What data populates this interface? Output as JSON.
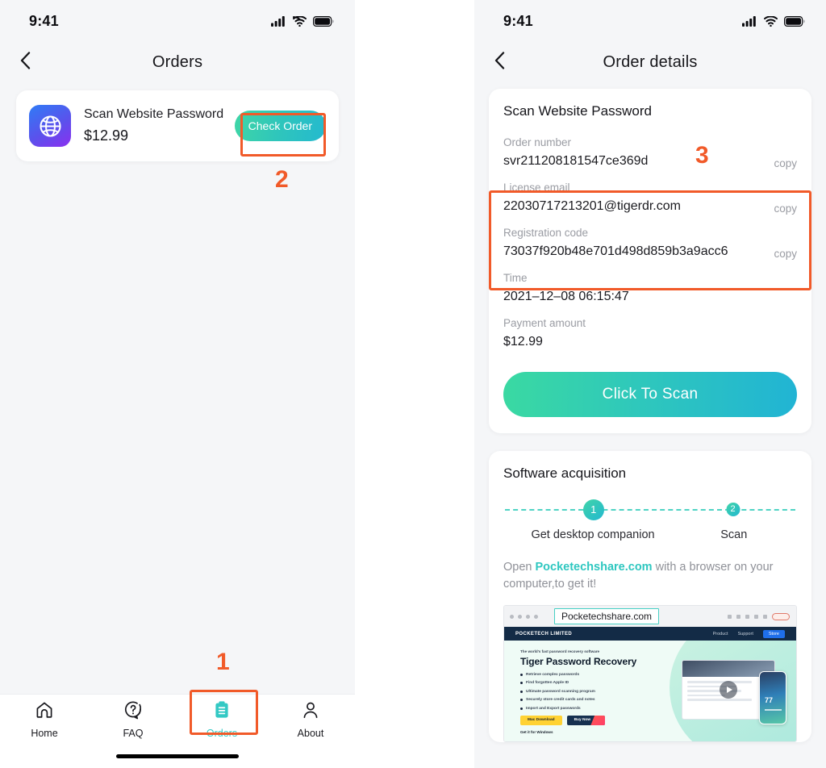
{
  "status_bar": {
    "time": "9:41"
  },
  "left_screen": {
    "header": {
      "title": "Orders",
      "back_icon": "chevron-left-icon"
    },
    "order": {
      "app_icon": "globe-icon",
      "name": "Scan Website Password",
      "price": "$12.99",
      "button_label": "Check Order"
    },
    "tabs": [
      {
        "label": "Home",
        "icon": "home-icon",
        "active": false
      },
      {
        "label": "FAQ",
        "icon": "question-icon",
        "active": false
      },
      {
        "label": "Orders",
        "icon": "clipboard-icon",
        "active": true
      },
      {
        "label": "About",
        "icon": "person-icon",
        "active": false
      }
    ]
  },
  "right_screen": {
    "header": {
      "title": "Order details",
      "back_icon": "chevron-left-icon"
    },
    "detail": {
      "title": "Scan Website Password",
      "copy_label": "copy",
      "fields": [
        {
          "label": "Order number",
          "value": "svr211208181547ce369d",
          "copy": true
        },
        {
          "label": "License email",
          "value": "22030717213201@tigerdr.com",
          "copy": true
        },
        {
          "label": "Registration code",
          "value": "73037f920b48e701d498d859b3a9acc6",
          "copy": true
        },
        {
          "label": "Time",
          "value": "2021–12–08 06:15:47",
          "copy": false
        },
        {
          "label": "Payment amount",
          "value": "$12.99",
          "copy": false
        }
      ],
      "scan_button_label": "Click To Scan"
    },
    "acquisition": {
      "title": "Software acquisition",
      "steps": [
        {
          "number": "1",
          "label": "Get desktop companion"
        },
        {
          "number": "2",
          "label": "Scan"
        }
      ],
      "note_before": "Open ",
      "note_brand": "Pocketechshare.com",
      "note_after": " with a browser on your computer,to get it!",
      "preview": {
        "url": "Pocketechshare.com",
        "site_brand": "POCKETECH LIMITED",
        "nav_items": [
          "Product",
          "Support"
        ],
        "nav_button": "Store",
        "kicker": "The world's fast password recovery software",
        "headline": "Tiger Password Recovery",
        "features": [
          "Retrieve complex passwords",
          "Find forgotten Apple ID",
          "Ultimate password scanning program",
          "Securely store credit cards and notes",
          "Import and Export passwords"
        ],
        "cta_mac": "Mac Download",
        "cta_buy": "Buy Now",
        "cta_windows": "Get it for Windows",
        "phone_number": "77"
      }
    }
  },
  "annotations": [
    {
      "number": "1"
    },
    {
      "number": "2"
    },
    {
      "number": "3"
    }
  ],
  "colors": {
    "accent_teal": "#2fc8bb",
    "annotation_orange": "#f15a29",
    "screen_bg": "#f5f6f8",
    "muted_text": "#9a9ca3"
  }
}
